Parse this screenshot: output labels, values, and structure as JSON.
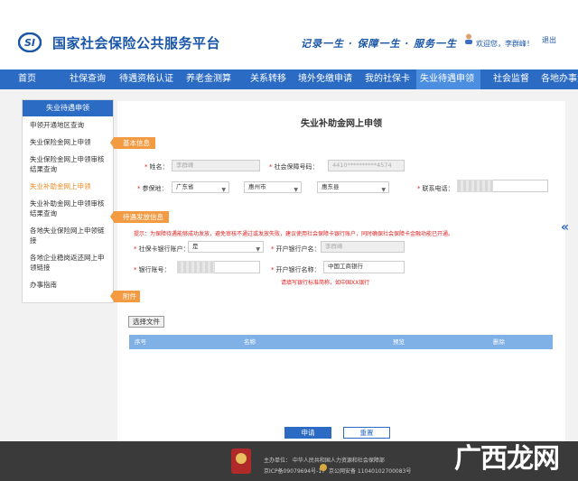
{
  "header": {
    "site_title": "国家社会保险公共服务平台",
    "slogan": "记录一生 · 保障一生 · 服务一生",
    "welcome": "欢迎您，李群峰！",
    "logout": "退出"
  },
  "nav": [
    "首页",
    "社保查询",
    "待遇资格认证",
    "养老金测算",
    "关系转移",
    "境外免缴申请",
    "我的社保卡",
    "失业待遇申领",
    "社会监督",
    "各地办事大厅"
  ],
  "nav_active": "失业待遇申领",
  "sidebar": {
    "title": "失业待遇申领",
    "items": [
      "申领开通地区查询",
      "失业保险金网上申领",
      "失业保险金网上申领审核结果查询",
      "失业补助金网上申领",
      "失业补助金网上申领审核结果查询",
      "各地失业保险网上申领链接",
      "各地企业稳岗返还网上申领链接",
      "办事指南"
    ]
  },
  "form": {
    "title": "失业补助金网上申领",
    "sections": {
      "basic": "基本信息",
      "payment": "待遇发放信息",
      "attachment": "附件"
    },
    "name_label": "姓名：",
    "name_value": "李群峰",
    "ssn_label": "社会保障号码：",
    "ssn_value": "4410**********4574",
    "insured_label": "参保地：",
    "province": "广东省",
    "city": "惠州市",
    "county": "惠东县",
    "phone_label": "联系电话：",
    "notice": "提示：为保障待遇能够成功发放，避免审核不通过或发放失败，建议使用社会保障卡银行账户，同时确保社会保障卡金融功能已开通。",
    "is_card_label": "社保卡银行账户：",
    "is_card_value": "是",
    "account_name_label": "开户银行户名：",
    "account_name_value": "李群峰",
    "bank_no_label": "银行账号：",
    "bank_name_label": "开户银行名称：",
    "bank_name_value": "中国工商银行",
    "bank_hint": "请填写银行标准简称，如中国XX银行",
    "choose_file": "选择文件",
    "table_headers": [
      "序号",
      "名称",
      "预览",
      "删除"
    ],
    "submit": "申请",
    "reset": "重置"
  },
  "collapse_icon": "«",
  "footer": {
    "sponsor": "主办单位：  中华人民共和国人力资源和社会保障部",
    "icp": "京ICP备09079694号-17",
    "police": "京公网安备 11040102700083号"
  },
  "watermark": "广西龙网"
}
